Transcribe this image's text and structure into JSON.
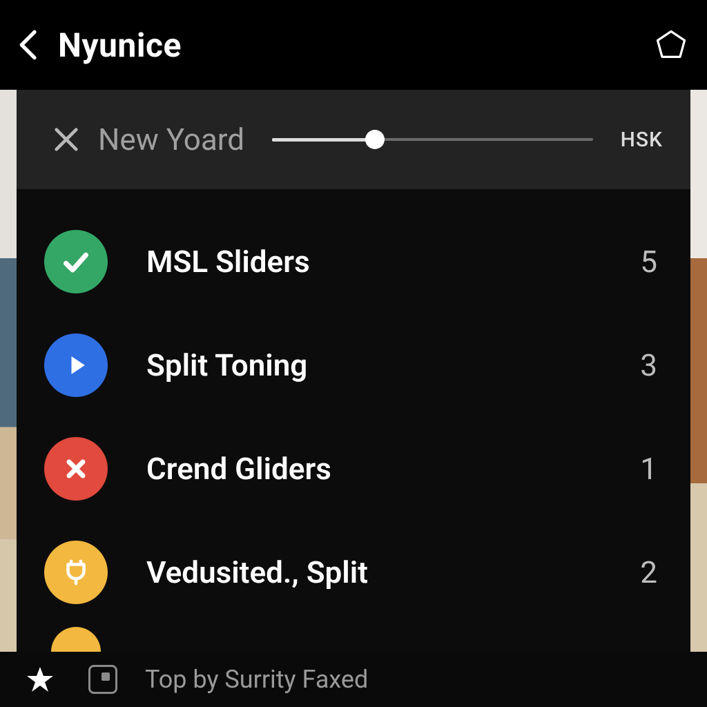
{
  "header": {
    "title": "Nyunice",
    "back_icon": "chevron-left",
    "right_icon": "tag"
  },
  "panel": {
    "close_icon": "x",
    "slider_label": "New Yoard",
    "slider_right_label": "HSK",
    "slider_percent": 32
  },
  "list": [
    {
      "icon": "check",
      "color": "green",
      "label": "MSL Sliders",
      "count": "5"
    },
    {
      "icon": "play",
      "color": "blue",
      "label": "Split Toning",
      "count": "3"
    },
    {
      "icon": "x",
      "color": "red",
      "label": "Crend Gliders",
      "count": "1"
    },
    {
      "icon": "plug",
      "color": "yellow",
      "label": "Vedusited., Split",
      "count": "2"
    }
  ],
  "footer": {
    "star_icon": "star",
    "square_icon": "copy-square",
    "text": "Top by Surrity Faxed"
  },
  "colors": {
    "green": "#34a767",
    "blue": "#2f6fe4",
    "red": "#e14a3d",
    "yellow": "#f3b83f"
  }
}
